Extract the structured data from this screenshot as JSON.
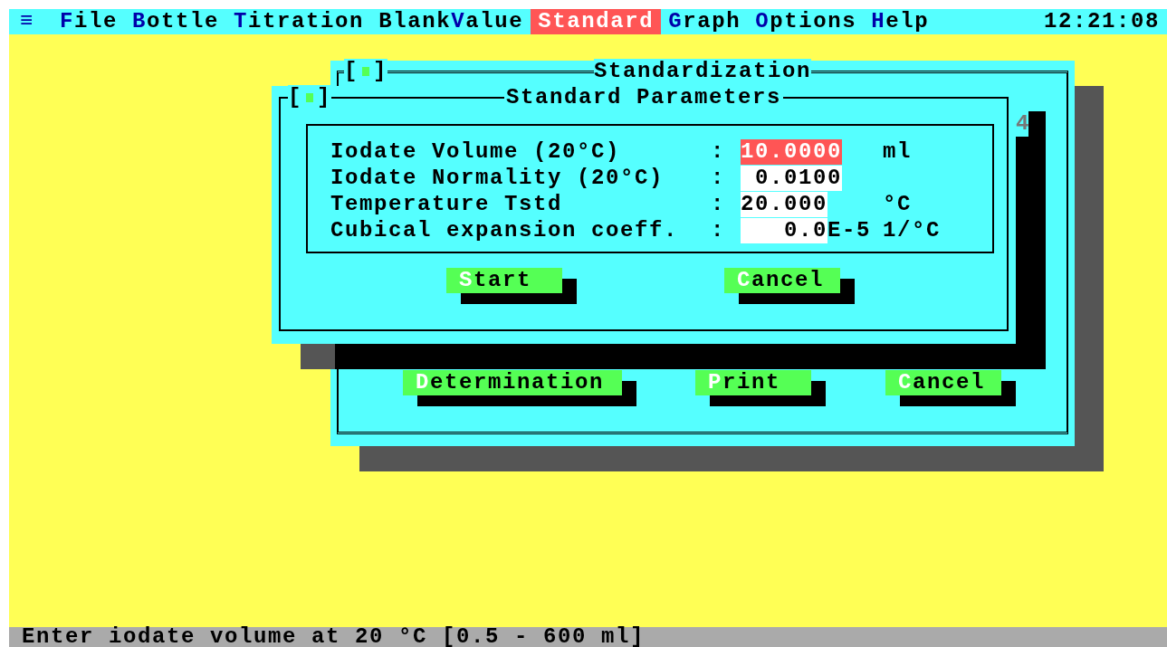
{
  "menu_bar": {
    "system_icon": "≡",
    "clock": "12:21:08",
    "items": [
      {
        "hotkey": "F",
        "after": "ile",
        "selected": false
      },
      {
        "hotkey": "B",
        "after": "ottle",
        "selected": false
      },
      {
        "hotkey": "T",
        "after": "itration",
        "selected": false
      },
      {
        "before": "Blank",
        "hotkey": "V",
        "after": "alue",
        "selected": false
      },
      {
        "hotkey": "S",
        "after": "tandard",
        "selected": true
      },
      {
        "hotkey": "G",
        "after": "raph",
        "selected": false
      },
      {
        "hotkey": "O",
        "after": "ptions",
        "selected": false
      },
      {
        "hotkey": "H",
        "after": "elp",
        "selected": false
      }
    ]
  },
  "standardization_window": {
    "title": "Standardization",
    "close_brackets": [
      "[",
      "]"
    ],
    "partial_text": "4",
    "buttons": [
      {
        "hotkey": "D",
        "rest": "etermination"
      },
      {
        "hotkey": "P",
        "rest": "rint"
      },
      {
        "hotkey": "C",
        "rest": "ancel"
      }
    ]
  },
  "parameters_dialog": {
    "title": "Standard Parameters",
    "close_brackets": [
      "[",
      "]"
    ],
    "fields": [
      {
        "label": "Iodate Volume (20°C)",
        "colon": ":",
        "value": "10.0000",
        "unit": "ml",
        "focused": true
      },
      {
        "label": "Iodate Normality (20°C)",
        "colon": ":",
        "value": "0.0100",
        "focused": false
      },
      {
        "label": "Temperature Tstd",
        "colon": ":",
        "value": "20.000",
        "unit": "°C",
        "focused": false
      },
      {
        "label": "Cubical expansion coeff.",
        "colon": ":",
        "value": "0.0",
        "suffix": "E-5",
        "unit": "1/°C",
        "focused": false
      }
    ],
    "buttons": [
      {
        "hotkey": "S",
        "rest": "tart"
      },
      {
        "hotkey": "C",
        "rest": "ancel"
      }
    ]
  },
  "status_bar": {
    "text": "Enter iodate volume at 20 °C [0.5 - 600 ml]"
  }
}
